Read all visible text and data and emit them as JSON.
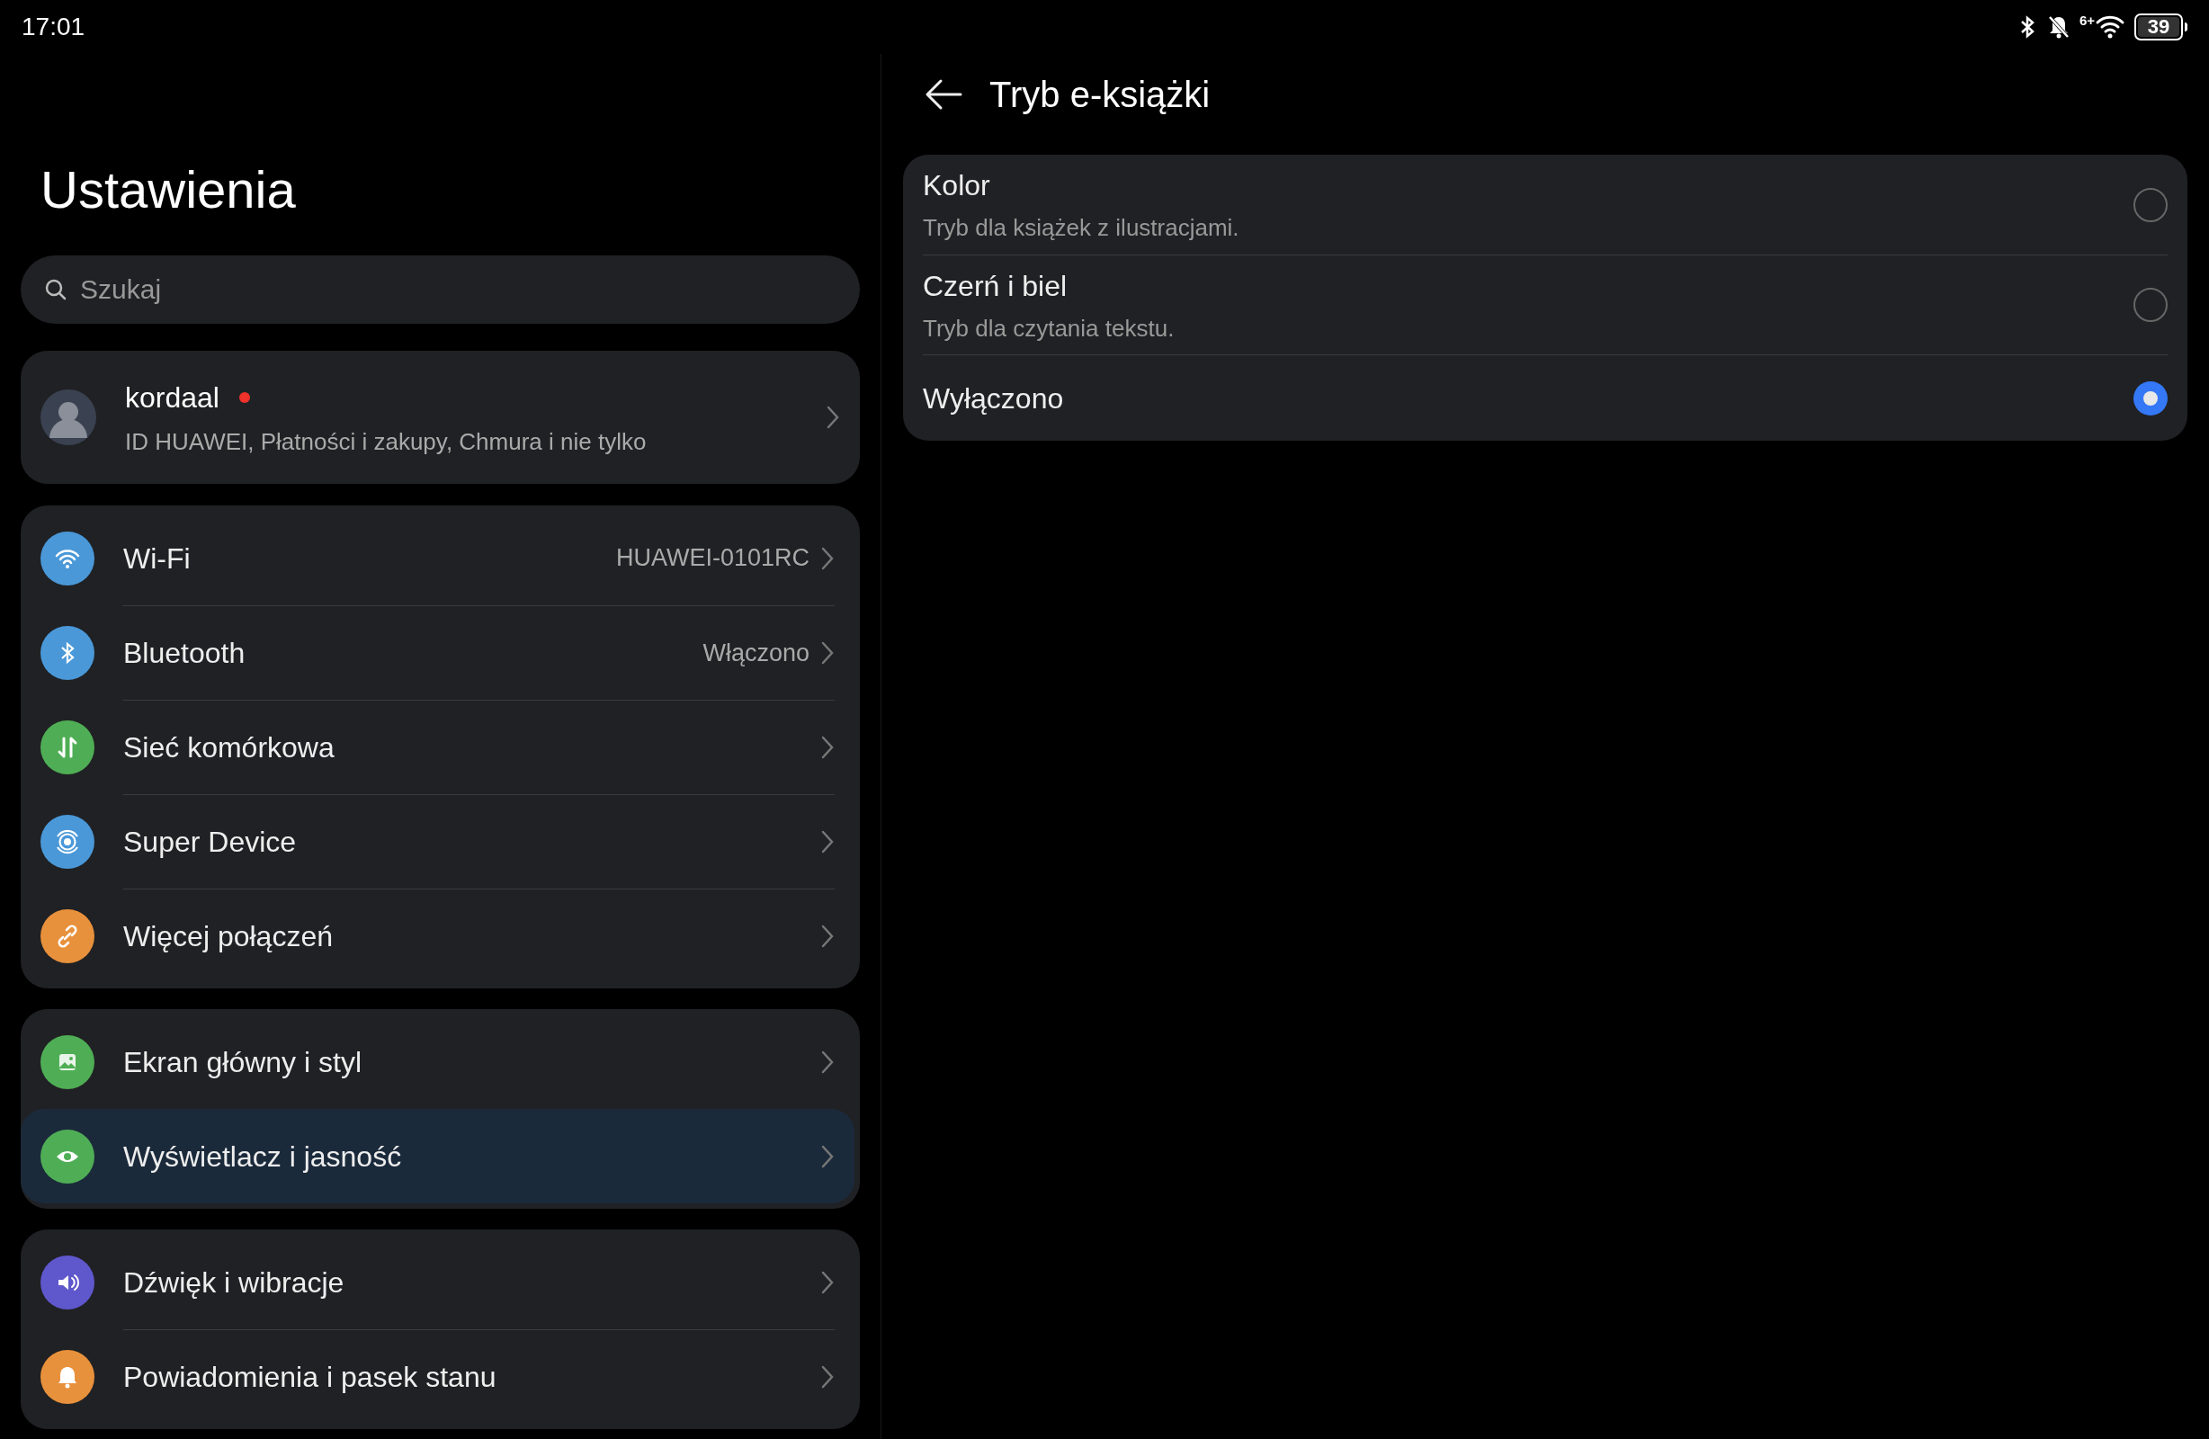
{
  "status_bar": {
    "time": "17:01",
    "wifi_badge": "6+",
    "battery": "39"
  },
  "settings": {
    "title": "Ustawienia",
    "search": {
      "placeholder": "Szukaj"
    },
    "account": {
      "name": "kordaal",
      "notification_dot": true,
      "subtitle": "ID HUAWEI, Płatności i zakupy, Chmura i nie tylko"
    },
    "groups": [
      {
        "items": [
          {
            "label": "Wi-Fi",
            "value": "HUAWEI-0101RC",
            "color": "#4a98d8",
            "selected": false
          },
          {
            "label": "Bluetooth",
            "value": "Włączono",
            "color": "#4a98d8",
            "selected": false
          },
          {
            "label": "Sieć komórkowa",
            "color": "#4fae55",
            "selected": false
          },
          {
            "label": "Super Device",
            "color": "#4a98d8",
            "selected": false
          },
          {
            "label": "Więcej połączeń",
            "color": "#e8913c",
            "selected": false
          }
        ]
      },
      {
        "items": [
          {
            "label": "Ekran główny i styl",
            "color": "#4fae55",
            "selected": false
          },
          {
            "label": "Wyświetlacz i jasność",
            "color": "#4fae55",
            "selected": true
          }
        ]
      },
      {
        "items": [
          {
            "label": "Dźwięk i wibracje",
            "color": "#5f57cc",
            "selected": false
          },
          {
            "label": "Powiadomienia i pasek stanu",
            "color": "#e8913c",
            "selected": false
          }
        ]
      }
    ]
  },
  "detail": {
    "title": "Tryb e-książki",
    "options": [
      {
        "label": "Kolor",
        "description": "Tryb dla książek z ilustracjami.",
        "selected": false
      },
      {
        "label": "Czerń i biel",
        "description": "Tryb dla czytania tekstu.",
        "selected": false
      },
      {
        "label": "Wyłączono",
        "selected": true
      }
    ]
  }
}
